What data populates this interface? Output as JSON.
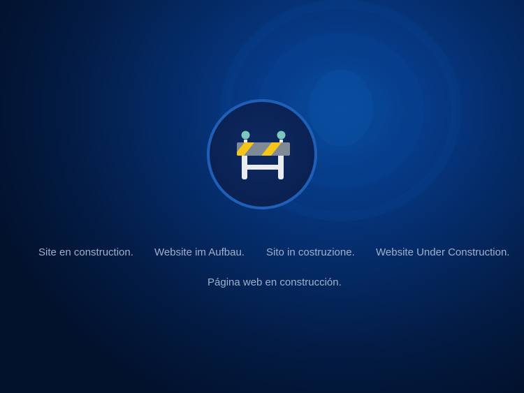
{
  "messages": {
    "french": "Site en construction.",
    "german": "Website im Aufbau.",
    "italian": "Sito in costruzione.",
    "english": "Website Under Construction.",
    "spanish": "Página web en construcción."
  },
  "icon": {
    "name": "construction-barrier-icon",
    "colors": {
      "stripe_yellow": "#f5c518",
      "stripe_gray": "#7f8a96",
      "frame_white": "#e8ecef",
      "lamp_teal": "#7cc7c0",
      "ring_blue": "#1f5fb8"
    }
  },
  "colors": {
    "background_dark": "#02122d",
    "background_glow": "#0a4d9c",
    "text": "#9fb1c9"
  }
}
